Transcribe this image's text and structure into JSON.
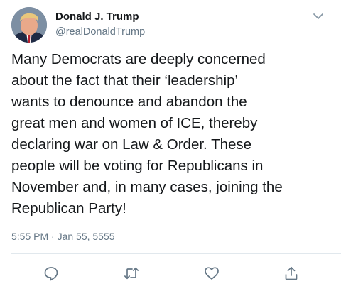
{
  "tweet": {
    "display_name": "Donald J. Trump",
    "handle": "@realDonaldTrump",
    "text": "Many Democrats are deeply concerned\nabout the fact that their ‘leadership’\nwants to denounce and abandon the\ngreat men and women of ICE, thereby\ndeclaring war on Law & Order. These\npeople will be voting for Republicans in\nNovember and, in many cases, joining the\nRepublican Party!",
    "timestamp": "5:55 PM · Jan 55, 5555"
  },
  "actions": [
    "reply-icon",
    "retweet-icon",
    "like-icon",
    "share-icon"
  ],
  "colors": {
    "text": "#14171a",
    "secondary": "#657786",
    "divider": "#e1e8ed"
  }
}
